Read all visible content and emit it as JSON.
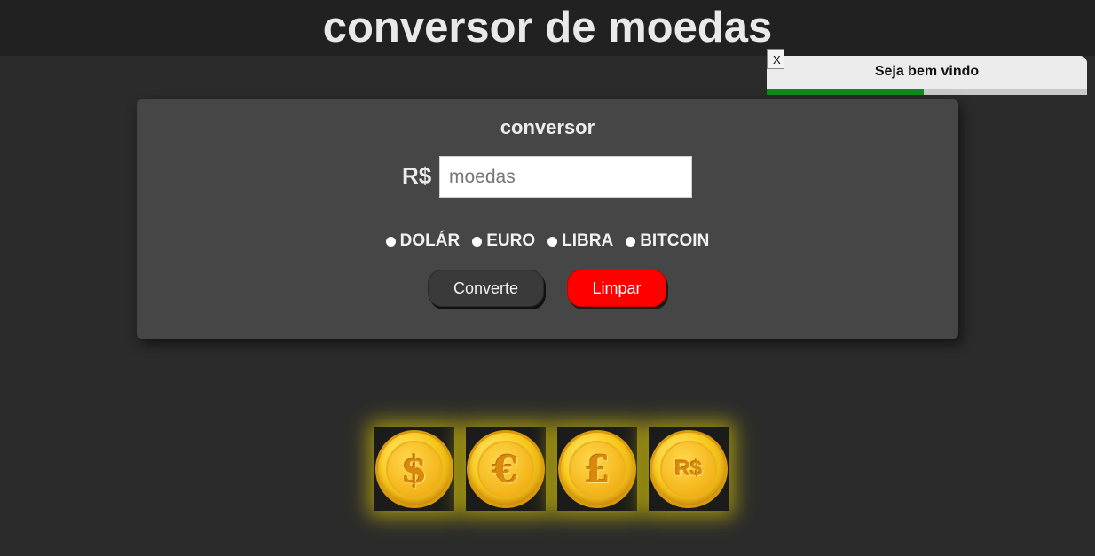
{
  "header": {
    "title": "conversor de moedas"
  },
  "toast": {
    "close_label": "X",
    "message": "Seja bem vindo",
    "progress": 0.49,
    "colors": {
      "bar": "#118a1d",
      "track": "#c9c9c9"
    }
  },
  "converter": {
    "title": "conversor",
    "currency_label": "R$",
    "amount_placeholder": "moedas",
    "amount_value": "",
    "options": [
      {
        "label": "DOLÁR"
      },
      {
        "label": "EURO"
      },
      {
        "label": "LIBRA"
      },
      {
        "label": "BITCOIN"
      }
    ],
    "convert_button": "Converte",
    "clear_button": "Limpar",
    "colors": {
      "clear": "#ff0000",
      "panel": "#464646"
    }
  },
  "coins": [
    {
      "symbol": "$",
      "icon": "dollar-coin-icon"
    },
    {
      "symbol": "€",
      "icon": "euro-coin-icon"
    },
    {
      "symbol": "£",
      "icon": "pound-coin-icon"
    },
    {
      "symbol": "R$",
      "icon": "real-coin-icon"
    }
  ]
}
